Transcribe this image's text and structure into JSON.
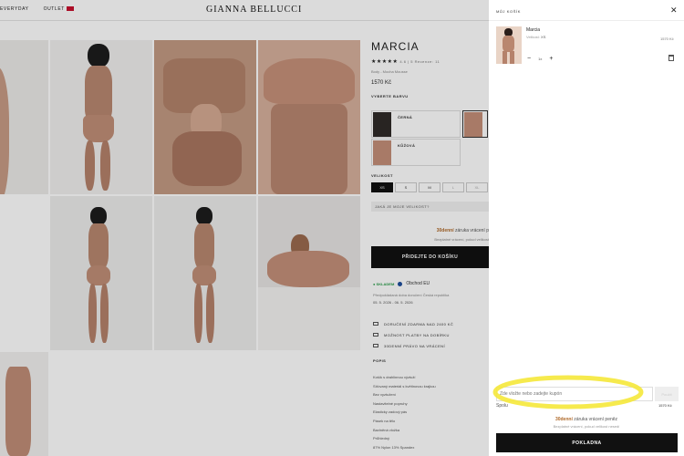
{
  "topbar": {
    "nav_everyday": "EVERYDAY",
    "nav_outlet": "OUTLET",
    "logo": "GIANNA BELLUCCI"
  },
  "product": {
    "title": "MARCIA",
    "stars": "★★★★★",
    "rating_text": "4.6 | 5 Recenze: 11",
    "subtitle": "Body - Mocha Mousse",
    "price": "1570 Kč",
    "choose_color_label": "VYBERTE BARVU",
    "colors": [
      {
        "name": "ČERNÁ",
        "swatch": "#2a2a2a"
      },
      {
        "name": "KŮŽOVÁ",
        "swatch": "#c48e78"
      }
    ],
    "size_label": "VELIKOST",
    "sizes": [
      "XS",
      "S",
      "M",
      "L",
      "XL"
    ],
    "size_help": "JAKÁ JE MOJE VELIKOST?",
    "return_days": "30denní",
    "return_text": " záruka vrácení p",
    "return_free": "Bezplatné vrácení, pokud velikost",
    "add_to_cart": "PŘIDEJTE DO KOŠÍKU",
    "stock_label": "● SKLADEM",
    "stock_origin": "Obchod EU",
    "delivery_note": "Předpokládaná doba doručení Česká republika",
    "delivery_dates": "05. 5. 2026 - 06. 5. 2026",
    "perks": [
      "DORUČENÍ ZDARMA NAD 2400 KČ",
      "MOŽNOST PLATBY NA DOBÍRKU",
      "30DENNÍ PRÁVO NA VRÁCENÍ"
    ],
    "description_label": "POPIS",
    "description": [
      "Košík s drahlinnou výztuží",
      "Síťovaný materiál s květinovou krajkou",
      "Bez vyztužení",
      "Nastavitelné popruhy",
      "Elasticky zadový pás",
      "Pásek na tělo",
      "Bavlněná vložka",
      "Průhledný",
      "87% Nylon 13% Spandex"
    ]
  },
  "cart": {
    "title": "MŮJ KOŠÍK",
    "close": "✕",
    "item": {
      "name": "Marcia",
      "variant_label": "Velikost:",
      "variant_value": "XS",
      "price": "1570 Kč",
      "qty": "1x",
      "minus": "−",
      "plus": "+"
    },
    "coupon_placeholder": "Zde vložte nebo zadejte kupón",
    "coupon_button": "Použít",
    "total_label": "Spolu",
    "total_value": "1570 Kč",
    "return_days": "30denní",
    "return_text": " záruka vrácení peněz",
    "return_free": "Bezplatné vrácení, pokud velikost nesedí",
    "checkout": "POKLADNA"
  },
  "colors": {
    "highlight": "#f5e83a",
    "accent_return": "#b06a2a",
    "stock_green": "#2a9d4a",
    "eu_blue": "#1f4e9c"
  }
}
